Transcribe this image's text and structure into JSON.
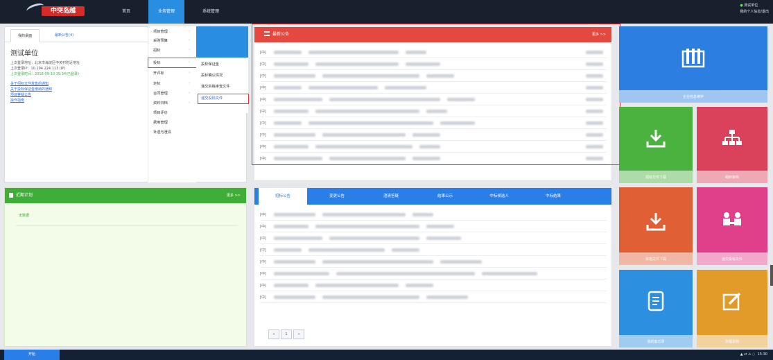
{
  "header": {
    "logo_text": "中突岛越",
    "nav": [
      "首页",
      "业务管理",
      "系统管理"
    ],
    "user_status": "测试单位",
    "user_sub": "我的个人信息/退出"
  },
  "left_top": {
    "tabs": [
      "我的桌面",
      "最新公告(4)"
    ],
    "unit_name": "测试单位",
    "info": [
      "上次登录地址：北京市海淀区中关村附近地址",
      "上次登录IP：10.194.224.113 (IP)",
      "上次登录时间：2018-09-10 19:34(已登录)"
    ],
    "links": [
      "关于招标文件发售的通知",
      "关于投标保证金缴纳的通知",
      "项目答疑公告",
      "操作指南"
    ]
  },
  "menu1": {
    "items": [
      "项目管理",
      "采购预算",
      "招标",
      "投标",
      "开评标",
      "定标",
      "合同管理",
      "资料归档",
      "项目评价",
      "费用管理",
      "补遗与澄清"
    ]
  },
  "menu2": {
    "items": [
      "投标保证金",
      "投标确认情况",
      "递交资格审查文件",
      "递交投标文件"
    ]
  },
  "center_top": {
    "title": "最新公告",
    "more": "更多 >>",
    "row_prefix": "[中]"
  },
  "left_bot": {
    "title": "近期计划",
    "more": "更多 >>",
    "empty": "无数据"
  },
  "center_bot": {
    "tabs": [
      "招标公告",
      "变更公告",
      "澄清答疑",
      "结果公示",
      "中标候选人",
      "中标结果"
    ],
    "row_prefix": "[中]",
    "pager": [
      "«",
      "1",
      "»"
    ]
  },
  "tiles": {
    "t1": "企业信息维护",
    "t2": "招标文件下载",
    "t3": "组织架构",
    "t4": "资格文件下载",
    "t5": "递交投标文件",
    "t6": "我的备忘录",
    "t7": "流程说明"
  },
  "taskbar": {
    "start": "开始",
    "time": "15:30"
  },
  "colors": {
    "red": "#e5483f",
    "green": "#3fae37",
    "blue": "#2a7ee8",
    "tile_orange": "#e05f35",
    "tile_pink": "#e03f89",
    "tile_green": "#4cb23f",
    "tile_rose": "#d9425a",
    "tile_blue": "#2c8fe0",
    "tile_amber": "#e29b28"
  }
}
